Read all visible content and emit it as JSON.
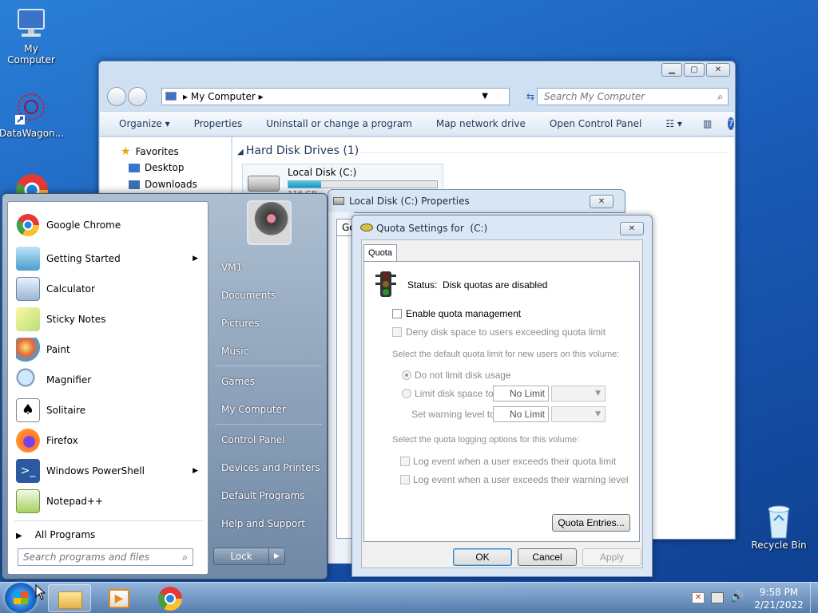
{
  "desktop": {
    "icons": [
      "My Computer",
      "DataWagon...",
      "Recycle Bin"
    ]
  },
  "explorer": {
    "address_label": "My Computer",
    "search_placeholder": "Search My Computer",
    "commands": [
      "Organize",
      "Properties",
      "Uninstall or change a program",
      "Map network drive",
      "Open Control Panel"
    ],
    "nav": {
      "favorites": "Favorites",
      "desktop": "Desktop",
      "downloads": "Downloads"
    },
    "section_title": "Hard Disk Drives (1)",
    "drive_name": "Local Disk (C:)",
    "drive_size_partial": "116 GB",
    "drive_usage_fraction": 0.22
  },
  "start_menu": {
    "programs": [
      "Google Chrome",
      "Getting Started",
      "Calculator",
      "Sticky Notes",
      "Paint",
      "Magnifier",
      "Solitaire",
      "Firefox",
      "Windows PowerShell",
      "Notepad++"
    ],
    "all_programs": "All Programs",
    "search_placeholder": "Search programs and files",
    "right_items": [
      "VM1",
      "Documents",
      "Pictures",
      "Music",
      "Games",
      "My Computer",
      "Control Panel",
      "Devices and Printers",
      "Default Programs",
      "Help and Support"
    ],
    "lock_label": "Lock"
  },
  "properties_dialog": {
    "title": "Local Disk (C:) Properties",
    "tab_partial": "Ge"
  },
  "quota_dialog": {
    "title": "Quota Settings for  (C:)",
    "tab": "Quota",
    "status": "Status:  Disk quotas are disabled",
    "enable_label": "Enable quota management",
    "deny_label": "Deny disk space to users exceeding quota limit",
    "default_limit_heading": "Select the default quota limit for new users on this volume:",
    "no_limit_radio": "Do not limit disk usage",
    "limit_radio": "Limit disk space to",
    "warning_label": "Set warning level to",
    "limit_value": "No Limit",
    "warning_value": "No Limit",
    "logging_heading": "Select the quota logging options for this volume:",
    "log_limit_label": "Log event when a user exceeds their quota limit",
    "log_warning_label": "Log event when a user exceeds their warning level",
    "entries_button": "Quota Entries...",
    "ok": "OK",
    "cancel": "Cancel",
    "apply": "Apply"
  },
  "taskbar": {
    "time": "9:58 PM",
    "date": "2/21/2022"
  }
}
